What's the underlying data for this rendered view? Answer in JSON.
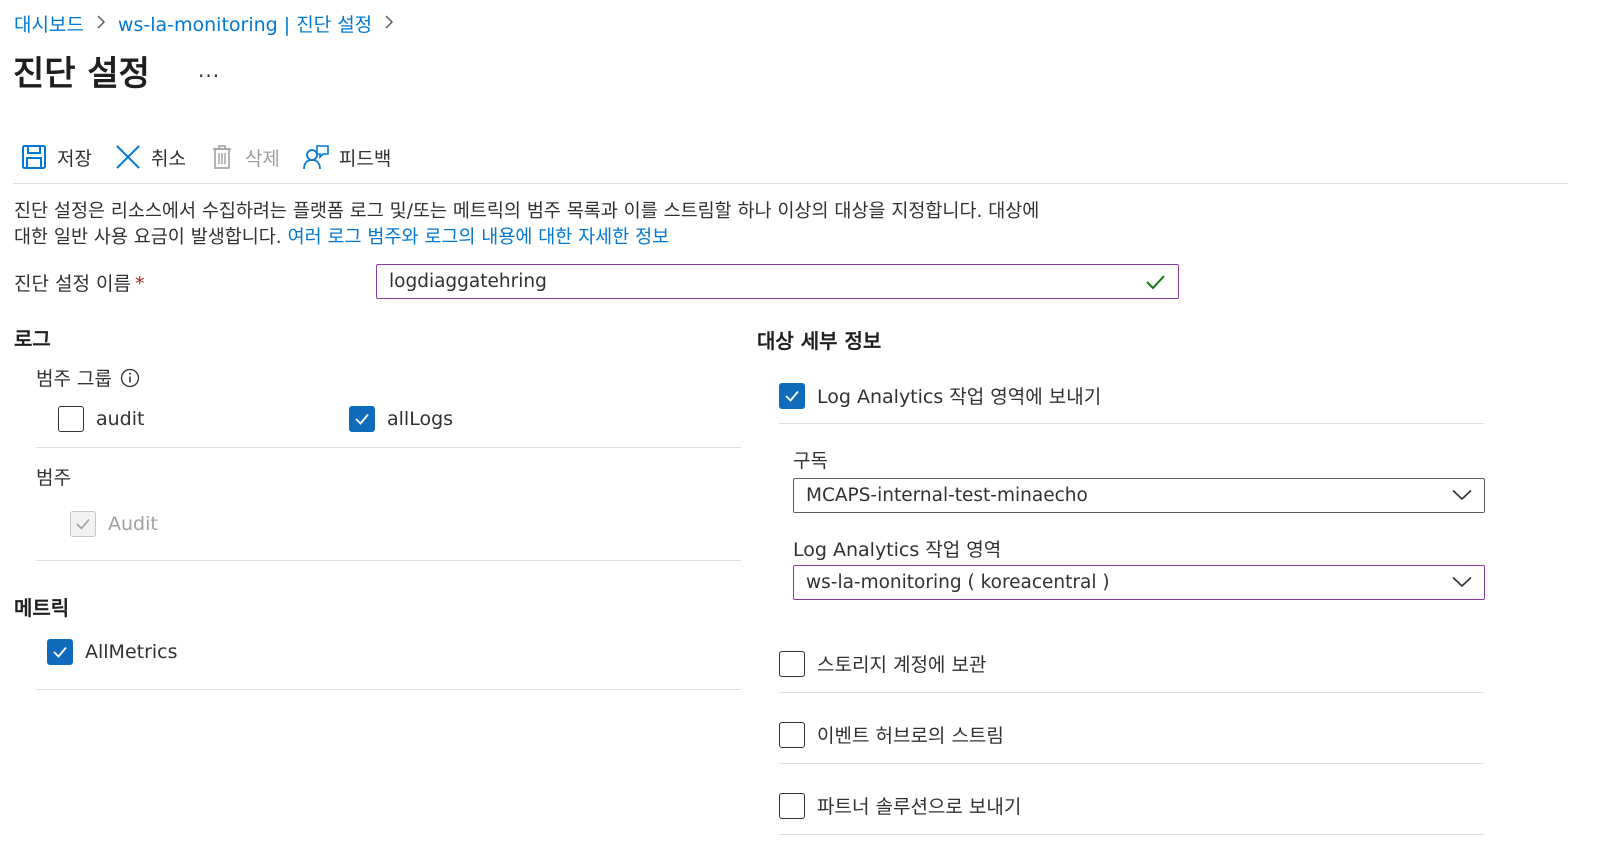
{
  "breadcrumb": {
    "items": [
      "대시보드",
      "ws-la-monitoring | 진단 설정"
    ]
  },
  "page": {
    "title": "진단 설정",
    "more": "..."
  },
  "toolbar": {
    "save": "저장",
    "cancel": "취소",
    "delete": "삭제",
    "feedback": "피드백"
  },
  "description": {
    "text": "진단 설정은 리소스에서 수집하려는 플랫폼 로그 및/또는 메트릭의 범주 목록과 이를 스트림할 하나 이상의 대상을 지정합니다. 대상에 대한 일반 사용 요금이 발생합니다.",
    "link": "여러 로그 범주와 로그의 내용에 대한 자세한 정보"
  },
  "name_field": {
    "label": "진단 설정 이름",
    "required_mark": "*",
    "value": "logdiaggatehring"
  },
  "logs": {
    "title": "로그",
    "category_groups_label": "범주 그룹",
    "category_groups": [
      {
        "label": "audit",
        "checked": false
      },
      {
        "label": "allLogs",
        "checked": true
      }
    ],
    "categories_label": "범주",
    "categories": [
      {
        "label": "Audit",
        "checked": true,
        "disabled": true
      }
    ]
  },
  "metrics": {
    "title": "메트릭",
    "items": [
      {
        "label": "AllMetrics",
        "checked": true
      }
    ]
  },
  "destination": {
    "title": "대상 세부 정보",
    "log_analytics": {
      "label": "Log Analytics 작업 영역에 보내기",
      "checked": true,
      "subscription_label": "구독",
      "subscription_value": "MCAPS-internal-test-minaecho",
      "workspace_label": "Log Analytics 작업 영역",
      "workspace_value": "ws-la-monitoring ( koreacentral )"
    },
    "storage": {
      "label": "스토리지 계정에 보관",
      "checked": false
    },
    "event_hub": {
      "label": "이벤트 허브로의 스트림",
      "checked": false
    },
    "partner": {
      "label": "파트너 솔루션으로 보내기",
      "checked": false
    }
  },
  "colors": {
    "accent": "#0078d4",
    "checkbox_checked": "#0f6cbd",
    "focus_border": "#8a3b9f",
    "success": "#107c10"
  }
}
